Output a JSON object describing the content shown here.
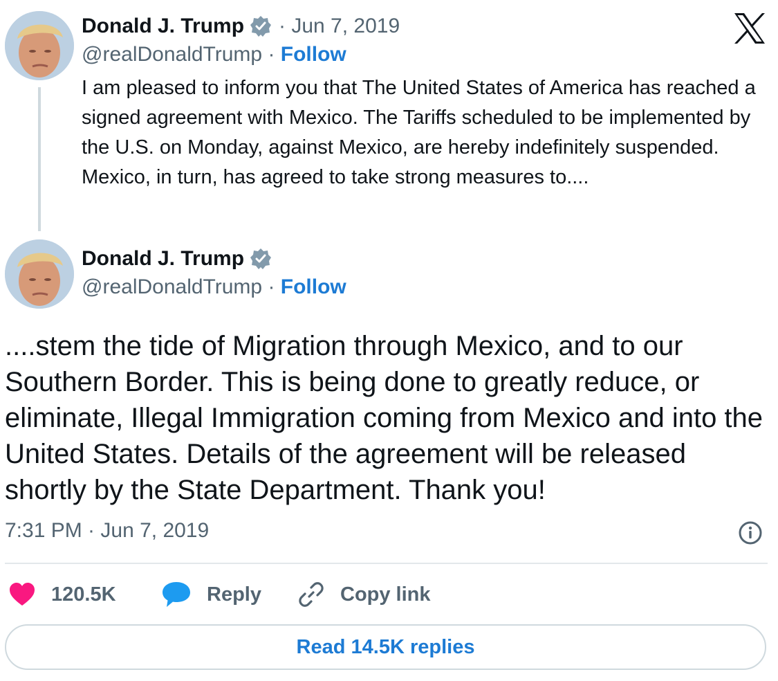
{
  "brand_logo": "X",
  "icons": {
    "verified": "verified-badge-icon",
    "like": "heart-icon",
    "reply": "speech-bubble-icon",
    "copy": "link-icon",
    "info": "info-icon",
    "close": "x-logo-icon"
  },
  "colors": {
    "link": "#1d7bd4",
    "muted": "#536471",
    "heart": "#f91880",
    "reply": "#1d9bf0",
    "badge": "#829aab"
  },
  "tweet1": {
    "author_name": "Donald J. Trump",
    "date": "· Jun 7, 2019",
    "handle": "@realDonaldTrump",
    "separator": " · ",
    "follow_label": "Follow",
    "text": "I am pleased to inform you that The United States of America has reached a signed agreement with Mexico. The Tariffs scheduled to be implemented by the U.S. on Monday, against Mexico, are hereby indefinitely suspended. Mexico, in turn, has agreed to take strong measures to...."
  },
  "tweet2": {
    "author_name": "Donald J. Trump",
    "handle": "@realDonaldTrump",
    "separator": " · ",
    "follow_label": "Follow",
    "text": "....stem the tide of Migration through Mexico, and to our Southern Border. This is being done to greatly reduce, or eliminate, Illegal Immigration coming from Mexico and into the United States. Details of the agreement will be released shortly by the State Department. Thank you!",
    "timestamp": "7:31 PM · Jun 7, 2019"
  },
  "actions": {
    "likes": "120.5K",
    "reply_label": "Reply",
    "copy_label": "Copy link"
  },
  "read_replies_label": "Read 14.5K replies"
}
